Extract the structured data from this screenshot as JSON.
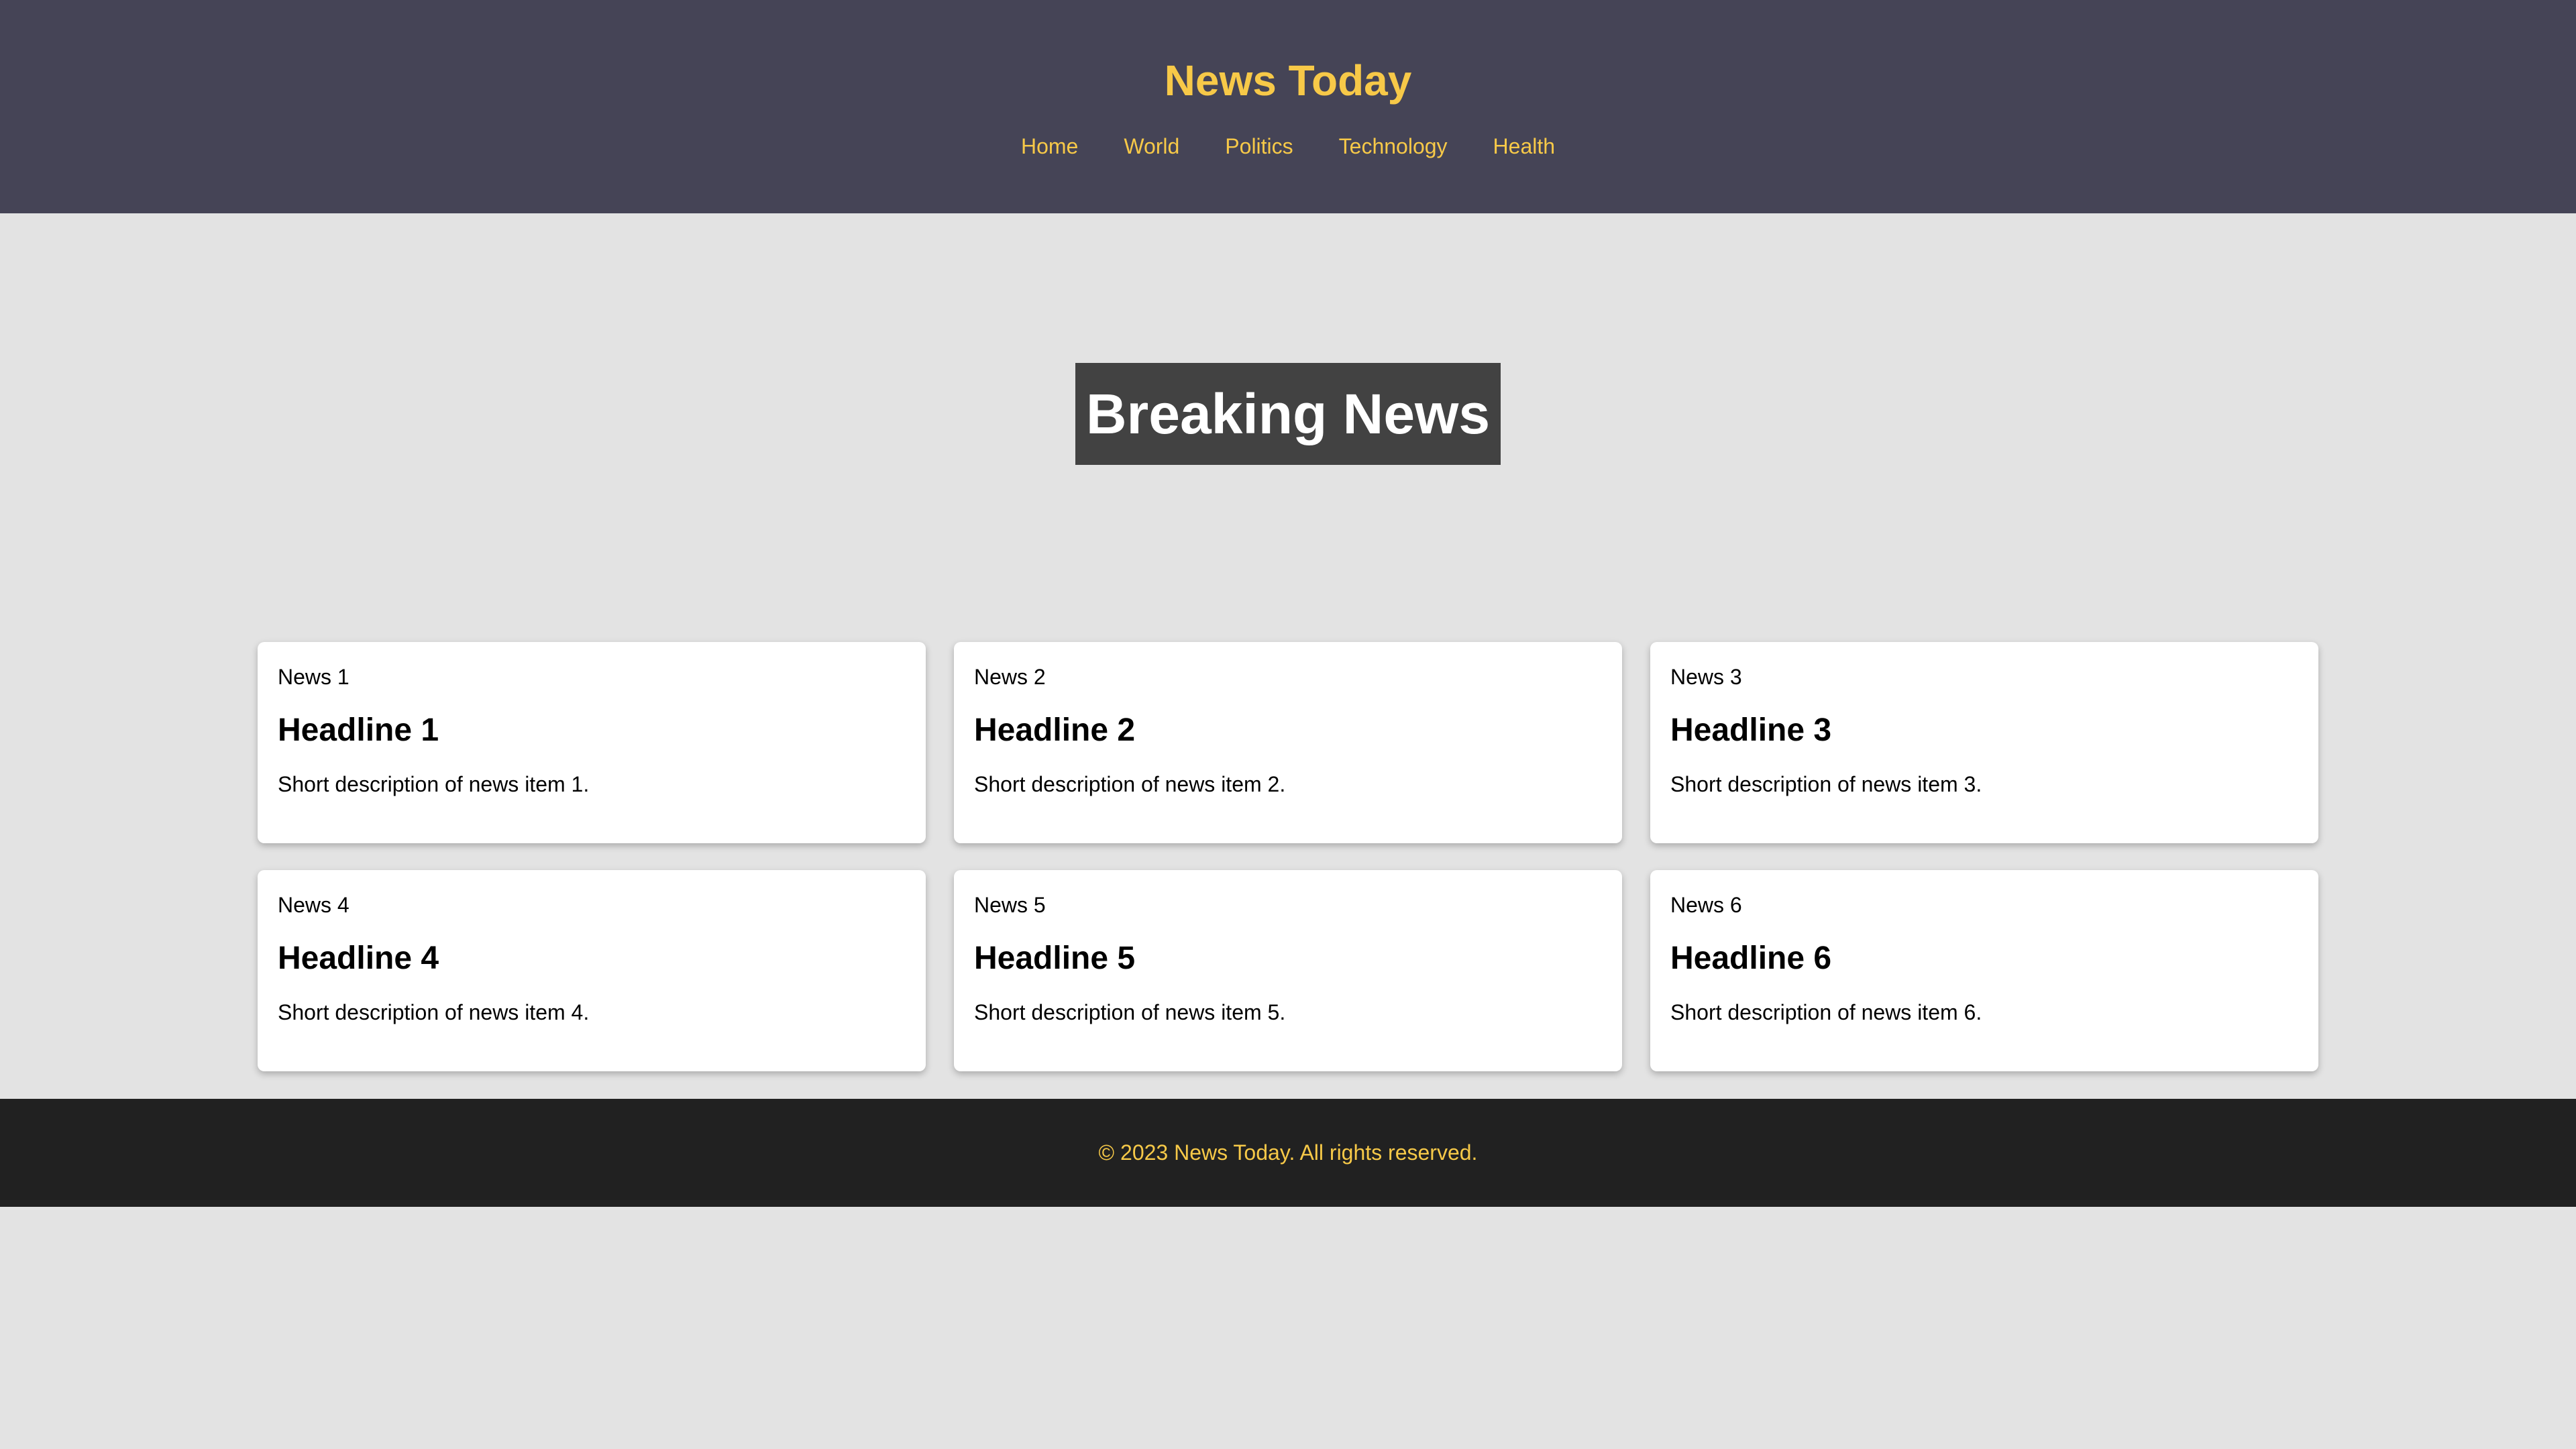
{
  "header": {
    "title": "News Today",
    "nav": [
      {
        "label": "Home"
      },
      {
        "label": "World"
      },
      {
        "label": "Politics"
      },
      {
        "label": "Technology"
      },
      {
        "label": "Health"
      }
    ]
  },
  "hero": {
    "title": "Breaking News"
  },
  "news": [
    {
      "img_alt": "News 1",
      "headline": "Headline 1",
      "description": "Short description of news item 1."
    },
    {
      "img_alt": "News 2",
      "headline": "Headline 2",
      "description": "Short description of news item 2."
    },
    {
      "img_alt": "News 3",
      "headline": "Headline 3",
      "description": "Short description of news item 3."
    },
    {
      "img_alt": "News 4",
      "headline": "Headline 4",
      "description": "Short description of news item 4."
    },
    {
      "img_alt": "News 5",
      "headline": "Headline 5",
      "description": "Short description of news item 5."
    },
    {
      "img_alt": "News 6",
      "headline": "Headline 6",
      "description": "Short description of news item 6."
    }
  ],
  "footer": {
    "text": "© 2023 News Today. All rights reserved."
  },
  "colors": {
    "header_bg": "#454456",
    "accent": "#f7c948",
    "page_bg": "#e3e3e3",
    "hero_box": "#424242",
    "footer_bg": "#212121"
  }
}
